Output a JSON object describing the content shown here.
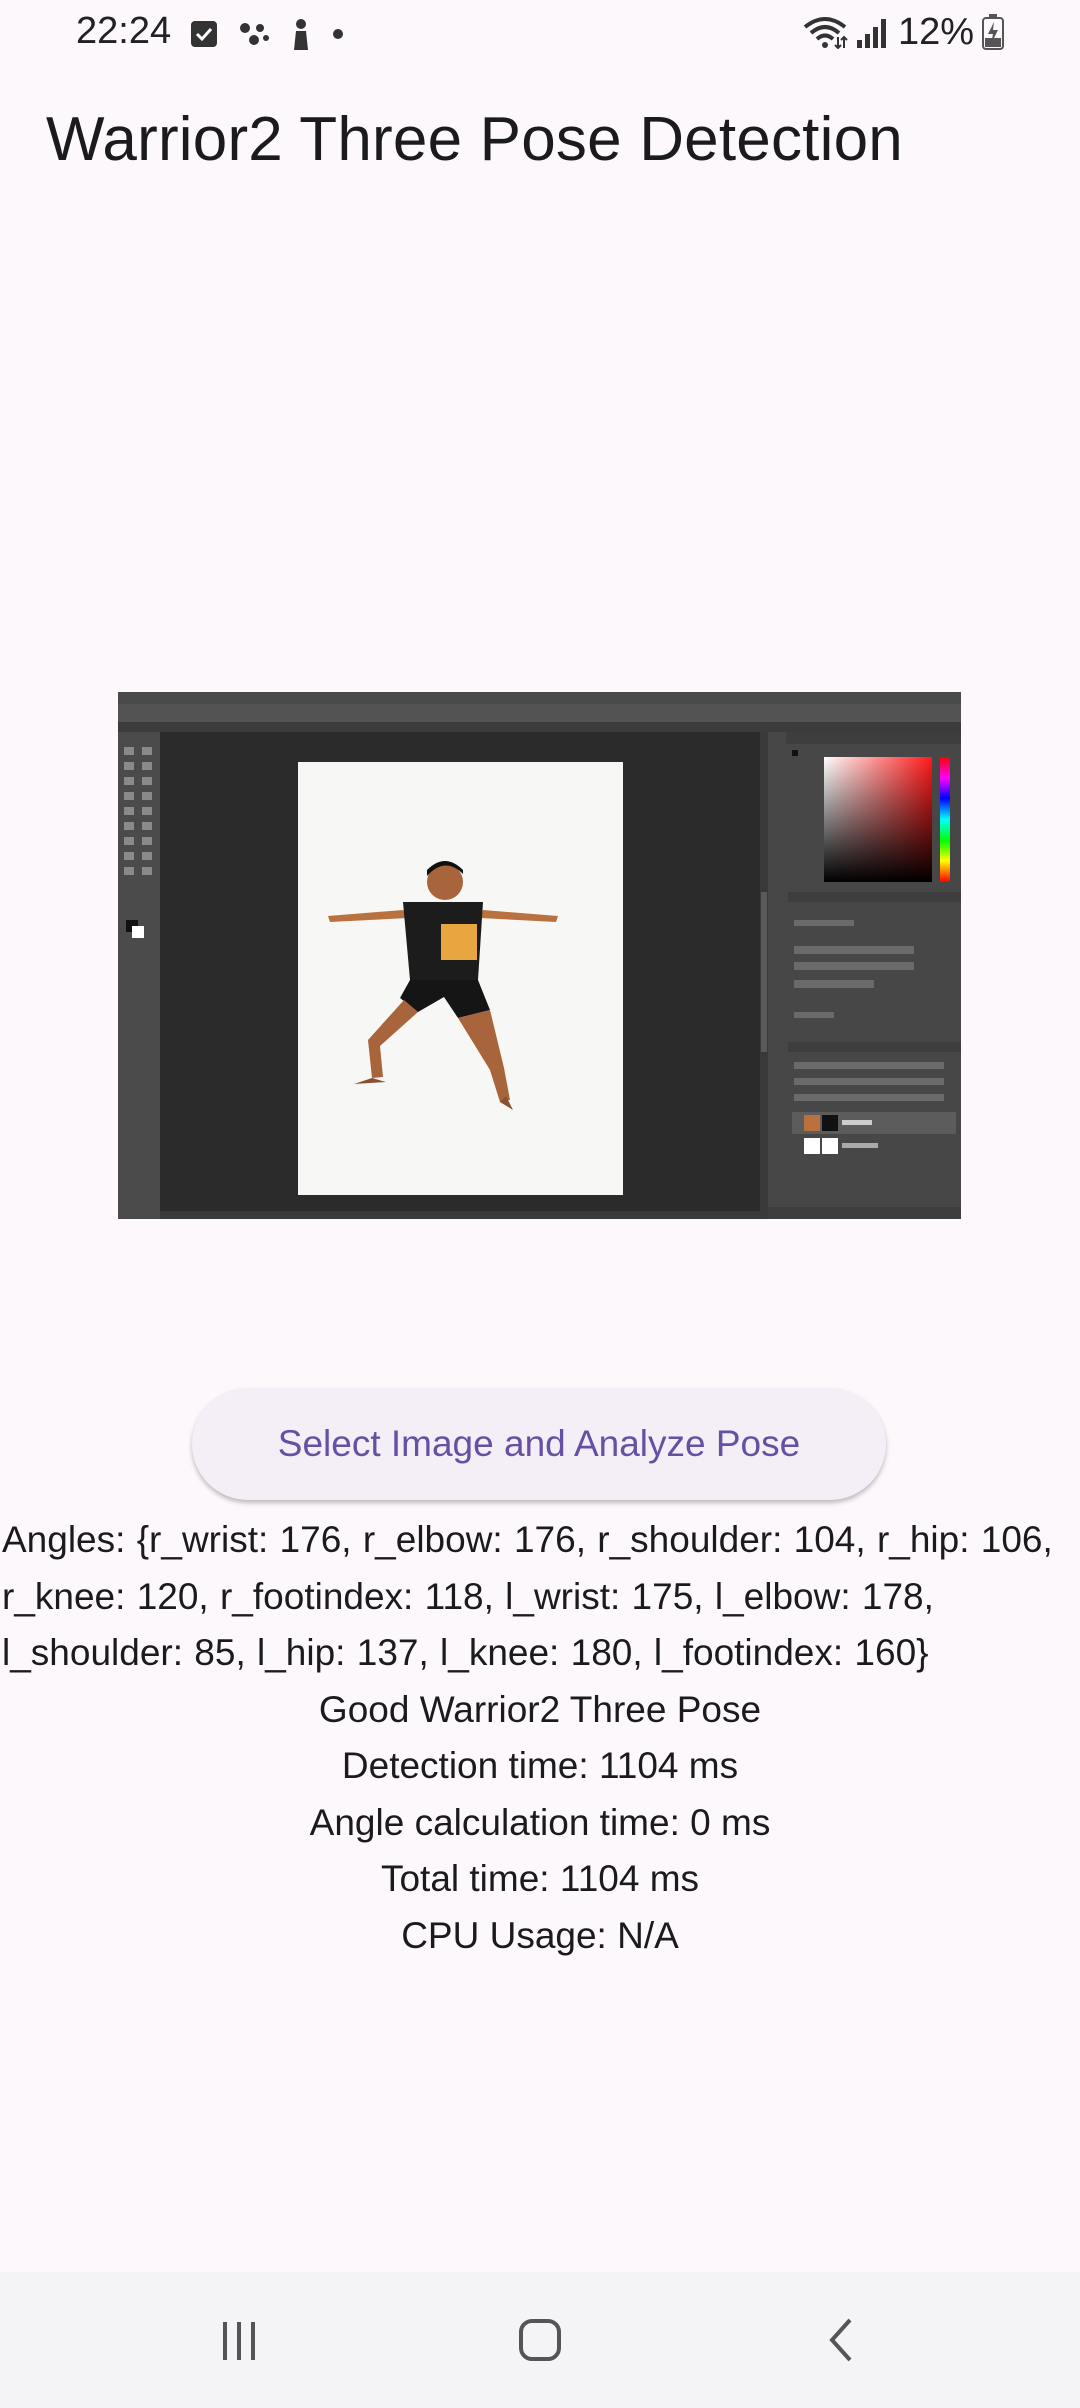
{
  "status_bar": {
    "time": "22:24",
    "battery": "12%",
    "left_icons": [
      "checkbox-notification-icon",
      "assistant-dots-icon",
      "person-icon",
      "dot-icon"
    ],
    "right_icons": [
      "wifi-icon",
      "signal-icon",
      "battery-charging-icon"
    ]
  },
  "app_bar": {
    "title": "Warrior2 Three Pose Detection"
  },
  "image": {
    "description_icon": "photoshop-screenshot-image"
  },
  "action": {
    "button_label": "Select Image and Analyze Pose"
  },
  "results": {
    "angles": "Angles: {r_wrist: 176, r_elbow: 176, r_shoulder: 104, r_hip: 106, r_knee: 120, r_footindex: 118, l_wrist: 175, l_elbow: 178, l_shoulder: 85, l_hip: 137, l_knee: 180, l_footindex: 160}",
    "verdict": "Good Warrior2 Three Pose",
    "detection_time": "Detection time: 1104 ms",
    "angle_time": "Angle calculation time: 0 ms",
    "total_time": "Total time: 1104 ms",
    "cpu_usage": "CPU Usage: N/A"
  },
  "nav_bar": {
    "icons": [
      "recent-apps-icon",
      "home-icon",
      "back-icon"
    ]
  },
  "colors": {
    "background": "#fdf8fc",
    "button_bg": "#f4eff6",
    "button_text": "#6750a4",
    "nav_bg": "#f4f3f5"
  }
}
